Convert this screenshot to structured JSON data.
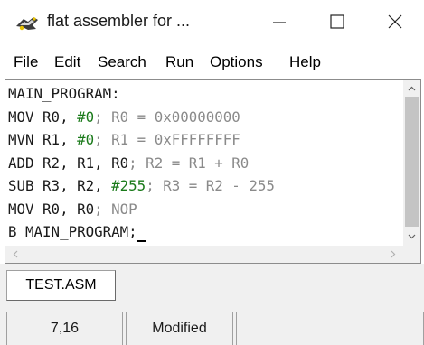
{
  "window": {
    "title": "flat assembler for ...",
    "icon": "flat-assembler-icon",
    "controls": [
      "minimize-icon",
      "maximize-icon",
      "close-icon"
    ]
  },
  "menu": {
    "items": [
      "File",
      "Edit",
      "Search",
      "Run",
      "Options",
      "Help"
    ]
  },
  "editor": {
    "lines": [
      [
        {
          "t": "MAIN_PROGRAM:",
          "k": "plain"
        }
      ],
      [
        {
          "t": "MOV R0, ",
          "k": "plain"
        },
        {
          "t": "#0",
          "k": "num"
        },
        {
          "t": "; R0 = 0x00000000",
          "k": "comment"
        }
      ],
      [
        {
          "t": "MVN R1, ",
          "k": "plain"
        },
        {
          "t": "#0",
          "k": "num"
        },
        {
          "t": "; R1 = 0xFFFFFFFF",
          "k": "comment"
        }
      ],
      [
        {
          "t": "ADD R2, R1, R0",
          "k": "plain"
        },
        {
          "t": "; R2 = R1 + R0",
          "k": "comment"
        }
      ],
      [
        {
          "t": "SUB R3, R2, ",
          "k": "plain"
        },
        {
          "t": "#255",
          "k": "num"
        },
        {
          "t": "; R3 = R2 - 255",
          "k": "comment"
        }
      ],
      [
        {
          "t": "MOV R0, R0",
          "k": "plain"
        },
        {
          "t": "; NOP",
          "k": "comment"
        }
      ],
      [
        {
          "t": "B MAIN_PROGRAM;",
          "k": "plain"
        }
      ]
    ],
    "colors": {
      "text": "#1a1a1a",
      "number": "#1a7a1a",
      "comment": "#8a8a8a"
    }
  },
  "tabs": [
    "TEST.ASM"
  ],
  "status": {
    "position": "7,16",
    "state": "Modified",
    "extra": ""
  }
}
